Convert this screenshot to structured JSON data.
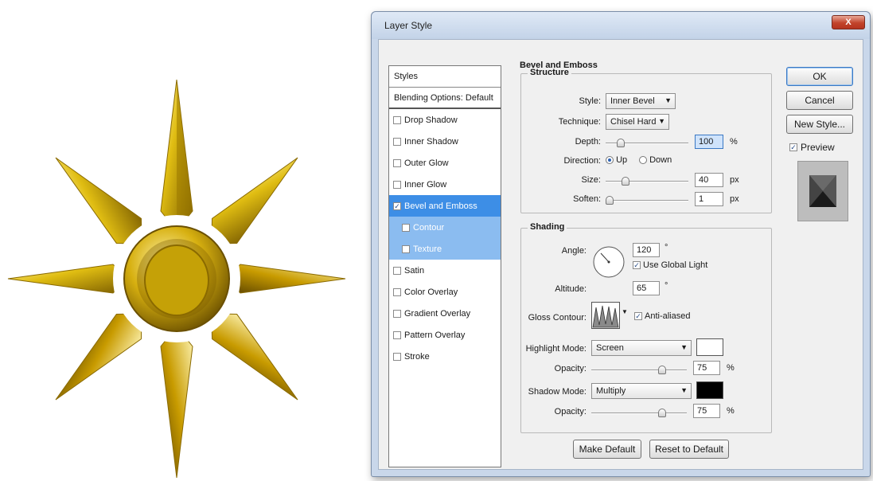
{
  "dialog": {
    "title": "Layer Style",
    "close_glyph": "X"
  },
  "styles_list": {
    "header": "Styles",
    "blending": "Blending Options: Default",
    "items": [
      {
        "label": "Drop Shadow",
        "checked": false
      },
      {
        "label": "Inner Shadow",
        "checked": false
      },
      {
        "label": "Outer Glow",
        "checked": false
      },
      {
        "label": "Inner Glow",
        "checked": false
      },
      {
        "label": "Bevel and Emboss",
        "checked": true
      },
      {
        "label": "Contour",
        "checked": false
      },
      {
        "label": "Texture",
        "checked": false
      },
      {
        "label": "Satin",
        "checked": false
      },
      {
        "label": "Color Overlay",
        "checked": false
      },
      {
        "label": "Gradient Overlay",
        "checked": false
      },
      {
        "label": "Pattern Overlay",
        "checked": false
      },
      {
        "label": "Stroke",
        "checked": false
      }
    ]
  },
  "bevel": {
    "title": "Bevel and Emboss",
    "structure": {
      "title": "Structure",
      "style_label": "Style:",
      "style_value": "Inner Bevel",
      "technique_label": "Technique:",
      "technique_value": "Chisel Hard",
      "depth_label": "Depth:",
      "depth_value": "100",
      "depth_unit": "%",
      "direction_label": "Direction:",
      "up_label": "Up",
      "down_label": "Down",
      "size_label": "Size:",
      "size_value": "40",
      "size_unit": "px",
      "soften_label": "Soften:",
      "soften_value": "1",
      "soften_unit": "px"
    },
    "shading": {
      "title": "Shading",
      "angle_label": "Angle:",
      "angle_value": "120",
      "degree": "°",
      "global_light_label": "Use Global Light",
      "altitude_label": "Altitude:",
      "altitude_value": "65",
      "gloss_label": "Gloss Contour:",
      "anti_aliased_label": "Anti-aliased",
      "highlight_mode_label": "Highlight Mode:",
      "highlight_mode_value": "Screen",
      "highlight_opacity_label": "Opacity:",
      "highlight_opacity_value": "75",
      "percent": "%",
      "shadow_mode_label": "Shadow Mode:",
      "shadow_mode_value": "Multiply",
      "shadow_opacity_label": "Opacity:",
      "shadow_opacity_value": "75",
      "highlight_color": "#ffffff",
      "shadow_color": "#000000"
    },
    "make_default": "Make Default",
    "reset_default": "Reset to Default"
  },
  "buttons": {
    "ok": "OK",
    "cancel": "Cancel",
    "new_style": "New Style...",
    "preview": "Preview"
  },
  "colors": {
    "selected": "#3d8ee6",
    "sub_selected": "#8bbcf0",
    "gold": "#d4b10c"
  }
}
